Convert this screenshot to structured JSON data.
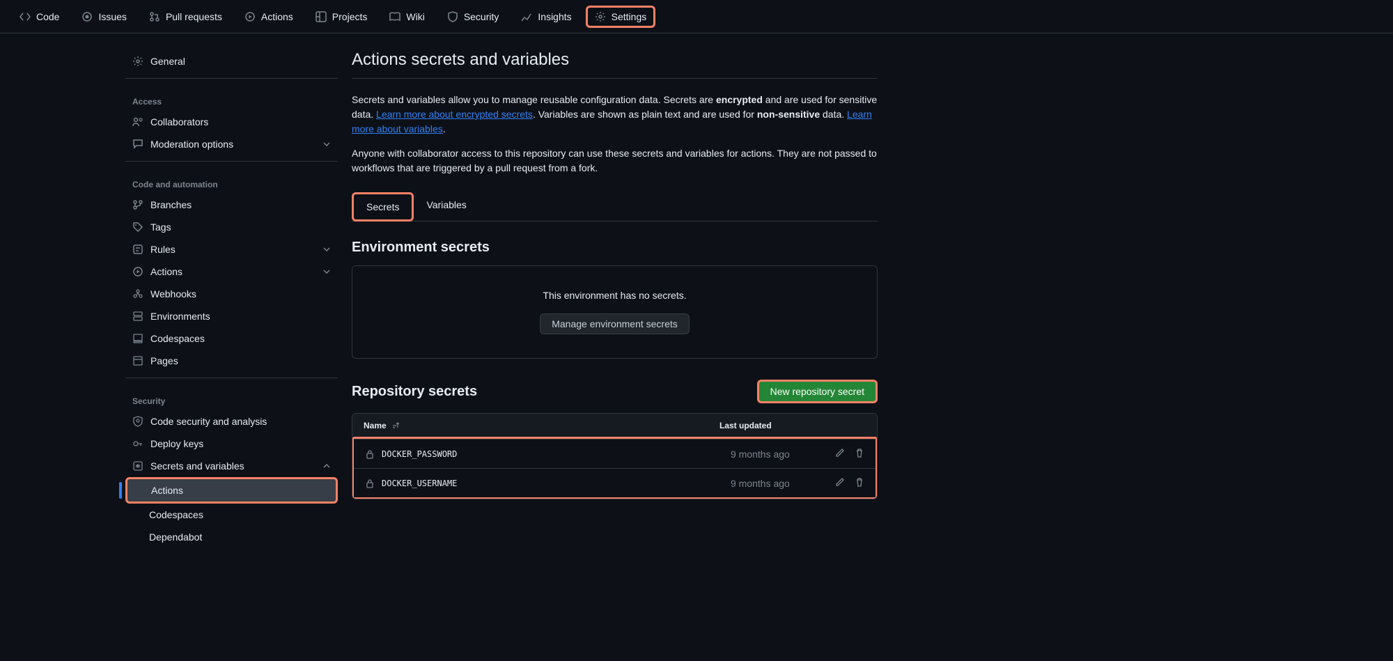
{
  "topnav": {
    "code": "Code",
    "issues": "Issues",
    "pull_requests": "Pull requests",
    "actions": "Actions",
    "projects": "Projects",
    "wiki": "Wiki",
    "security": "Security",
    "insights": "Insights",
    "settings": "Settings"
  },
  "sidebar": {
    "general": "General",
    "access_heading": "Access",
    "collaborators": "Collaborators",
    "moderation": "Moderation options",
    "code_heading": "Code and automation",
    "branches": "Branches",
    "tags": "Tags",
    "rules": "Rules",
    "actions": "Actions",
    "webhooks": "Webhooks",
    "environments": "Environments",
    "codespaces": "Codespaces",
    "pages": "Pages",
    "security_heading": "Security",
    "code_security": "Code security and analysis",
    "deploy_keys": "Deploy keys",
    "secrets_vars": "Secrets and variables",
    "sv_actions": "Actions",
    "sv_codespaces": "Codespaces",
    "sv_dependabot": "Dependabot"
  },
  "main": {
    "title": "Actions secrets and variables",
    "desc1_a": "Secrets and variables allow you to manage reusable configuration data. Secrets are ",
    "desc1_b": "encrypted",
    "desc1_c": " and are used for sensitive data. ",
    "link1": "Learn more about encrypted secrets",
    "desc1_d": ". Variables are shown as plain text and are used for ",
    "desc1_e": "non-sensitive",
    "desc1_f": " data. ",
    "link2": "Learn more about variables",
    "desc1_g": ".",
    "desc2": "Anyone with collaborator access to this repository can use these secrets and variables for actions. They are not passed to workflows that are triggered by a pull request from a fork.",
    "tab_secrets": "Secrets",
    "tab_variables": "Variables",
    "env_title": "Environment secrets",
    "env_empty": "This environment has no secrets.",
    "env_btn": "Manage environment secrets",
    "repo_title": "Repository secrets",
    "new_secret_btn": "New repository secret",
    "col_name": "Name",
    "col_date": "Last updated",
    "rows": [
      {
        "name": "DOCKER_PASSWORD",
        "date": "9 months ago"
      },
      {
        "name": "DOCKER_USERNAME",
        "date": "9 months ago"
      }
    ]
  }
}
